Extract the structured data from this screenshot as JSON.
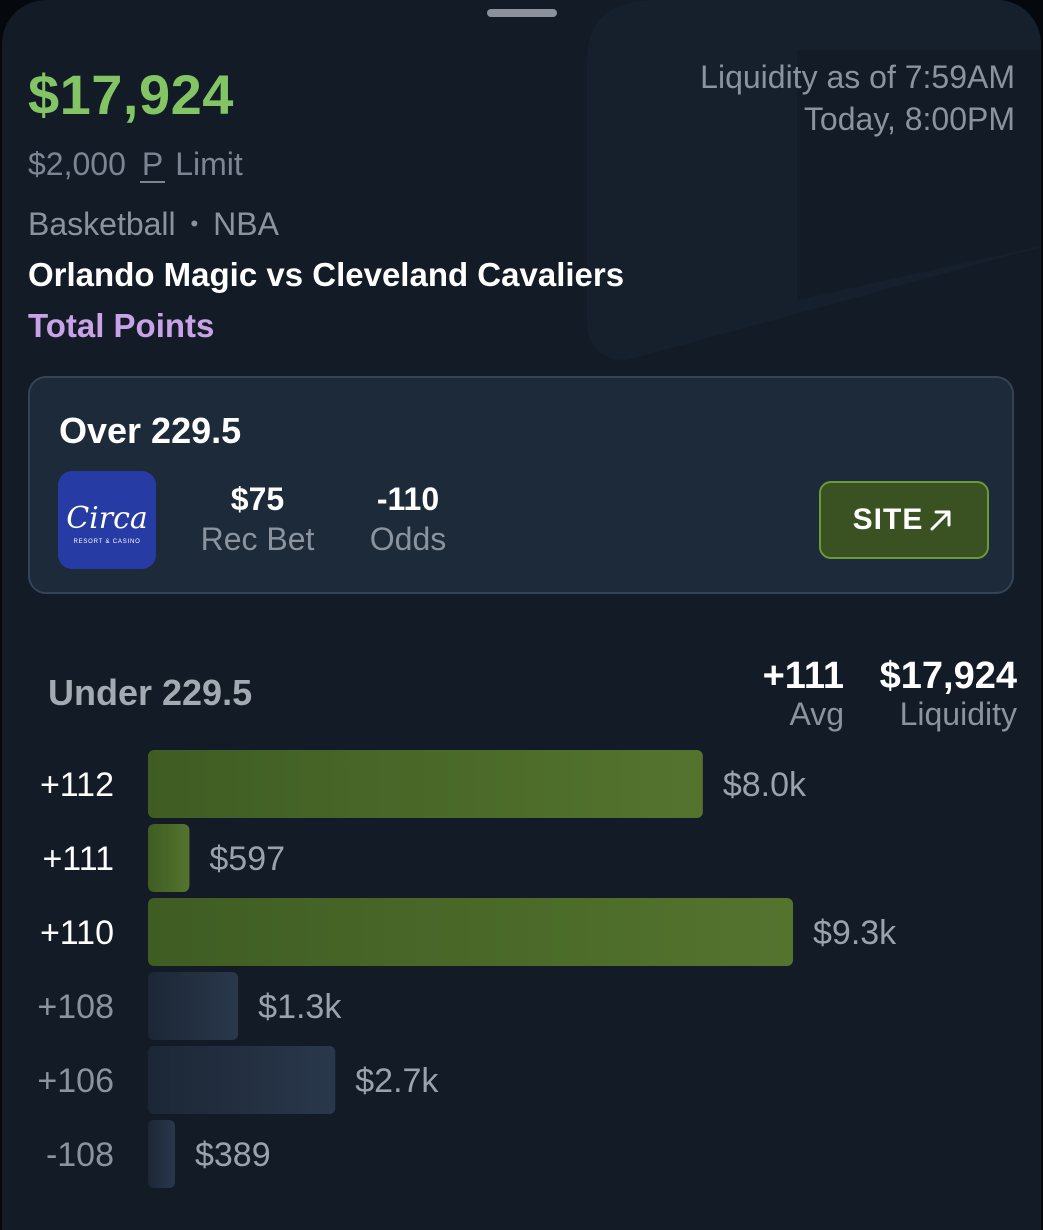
{
  "header": {
    "liquidity_amount": "$17,924",
    "liquidity_as_of": "Liquidity as of 7:59AM",
    "game_time": "Today, 8:00PM",
    "limit_amount": "$2,000",
    "limit_icon": "P",
    "limit_label": "Limit",
    "sport": "Basketball",
    "separator": "•",
    "league": "NBA",
    "matchup": "Orlando Magic vs Cleveland Cavaliers",
    "market": "Total Points"
  },
  "bet_card": {
    "title": "Over 229.5",
    "book_logo_text": "Circa",
    "book_logo_subtext": "RESORT & CASINO",
    "rec_bet_value": "$75",
    "rec_bet_label": "Rec Bet",
    "odds_value": "-110",
    "odds_label": "Odds",
    "site_button": "SITE",
    "site_icon": "arrow-up-right-icon"
  },
  "under_section": {
    "title": "Under 229.5",
    "avg_value": "+111",
    "avg_label": "Avg",
    "liquidity_value": "$17,924",
    "liquidity_label": "Liquidity"
  },
  "colors": {
    "accent_green": "#83c564",
    "purple": "#c9a3e8",
    "bar_green": "#4d6d2a",
    "bar_gray": "#253246"
  },
  "chart_data": {
    "type": "bar",
    "orientation": "horizontal",
    "categories": [
      "+112",
      "+111",
      "+110",
      "+108",
      "+106",
      "-108"
    ],
    "values": [
      8000,
      597,
      9300,
      1300,
      2700,
      389
    ],
    "value_labels": [
      "$8.0k",
      "$597",
      "$9.3k",
      "$1.3k",
      "$2.7k",
      "$389"
    ],
    "highlighted": [
      true,
      true,
      true,
      false,
      false,
      false
    ],
    "title": "",
    "xlabel": "",
    "ylabel": ""
  }
}
